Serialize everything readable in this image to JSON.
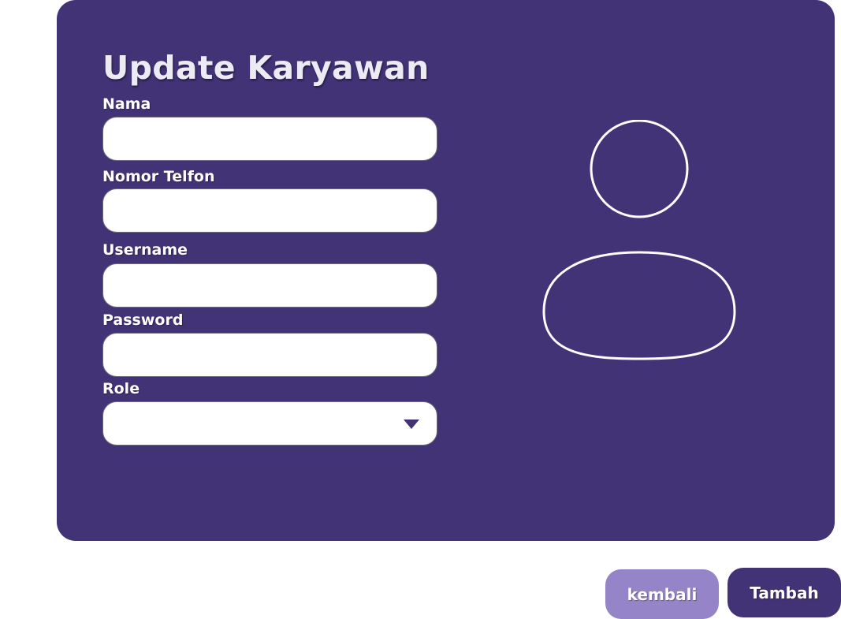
{
  "form": {
    "title": "Update Karyawan",
    "fields": {
      "nama": {
        "label": "Nama",
        "value": ""
      },
      "telfon": {
        "label": "Nomor Telfon",
        "value": ""
      },
      "username": {
        "label": "Username",
        "value": ""
      },
      "password": {
        "label": "Password",
        "value": ""
      },
      "role": {
        "label": "Role",
        "value": ""
      }
    }
  },
  "buttons": {
    "back_label": "kembali",
    "submit_label": "Tambah"
  },
  "colors": {
    "panel": "#423276",
    "back_button": "#9585c8",
    "submit_button": "#423276",
    "input_background": "#ffffff"
  },
  "icons": {
    "avatar": "user-avatar-icon",
    "dropdown": "chevron-down-icon"
  }
}
